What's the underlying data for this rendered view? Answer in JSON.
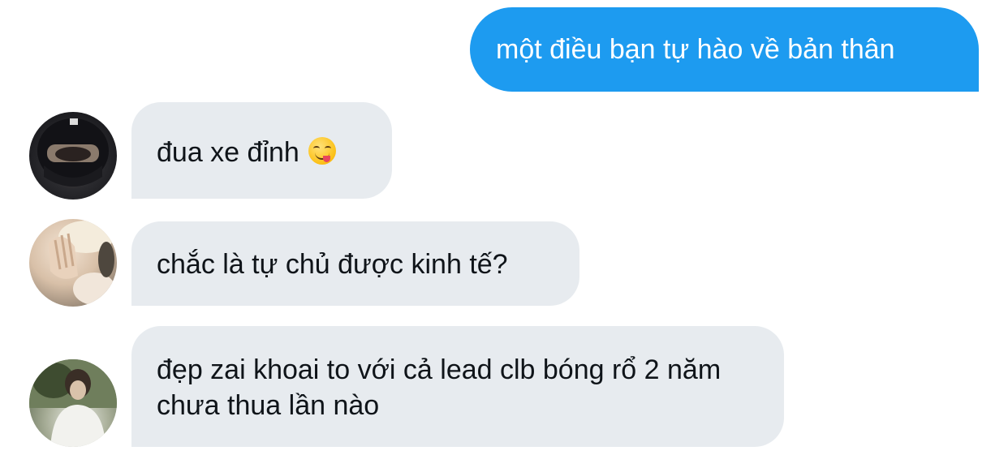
{
  "messages": {
    "sent": {
      "text": "một điều bạn tự hào về bản thân"
    },
    "received": [
      {
        "text": "đua xe đỉnh",
        "emoji": "yum-emoji",
        "avatar": "helmet-photo"
      },
      {
        "text": "chắc là tự chủ được kinh tế?",
        "avatar": "hands-on-face-photo"
      },
      {
        "text": "đẹp zai khoai to với cả lead clb bóng rổ 2 năm chưa thua lần nào",
        "avatar": "outdoor-portrait-photo"
      }
    ]
  },
  "colors": {
    "sent_bubble": "#1d9bf0",
    "received_bubble": "#e7ebef",
    "text_dark": "#0f1419",
    "text_light": "#ffffff"
  }
}
